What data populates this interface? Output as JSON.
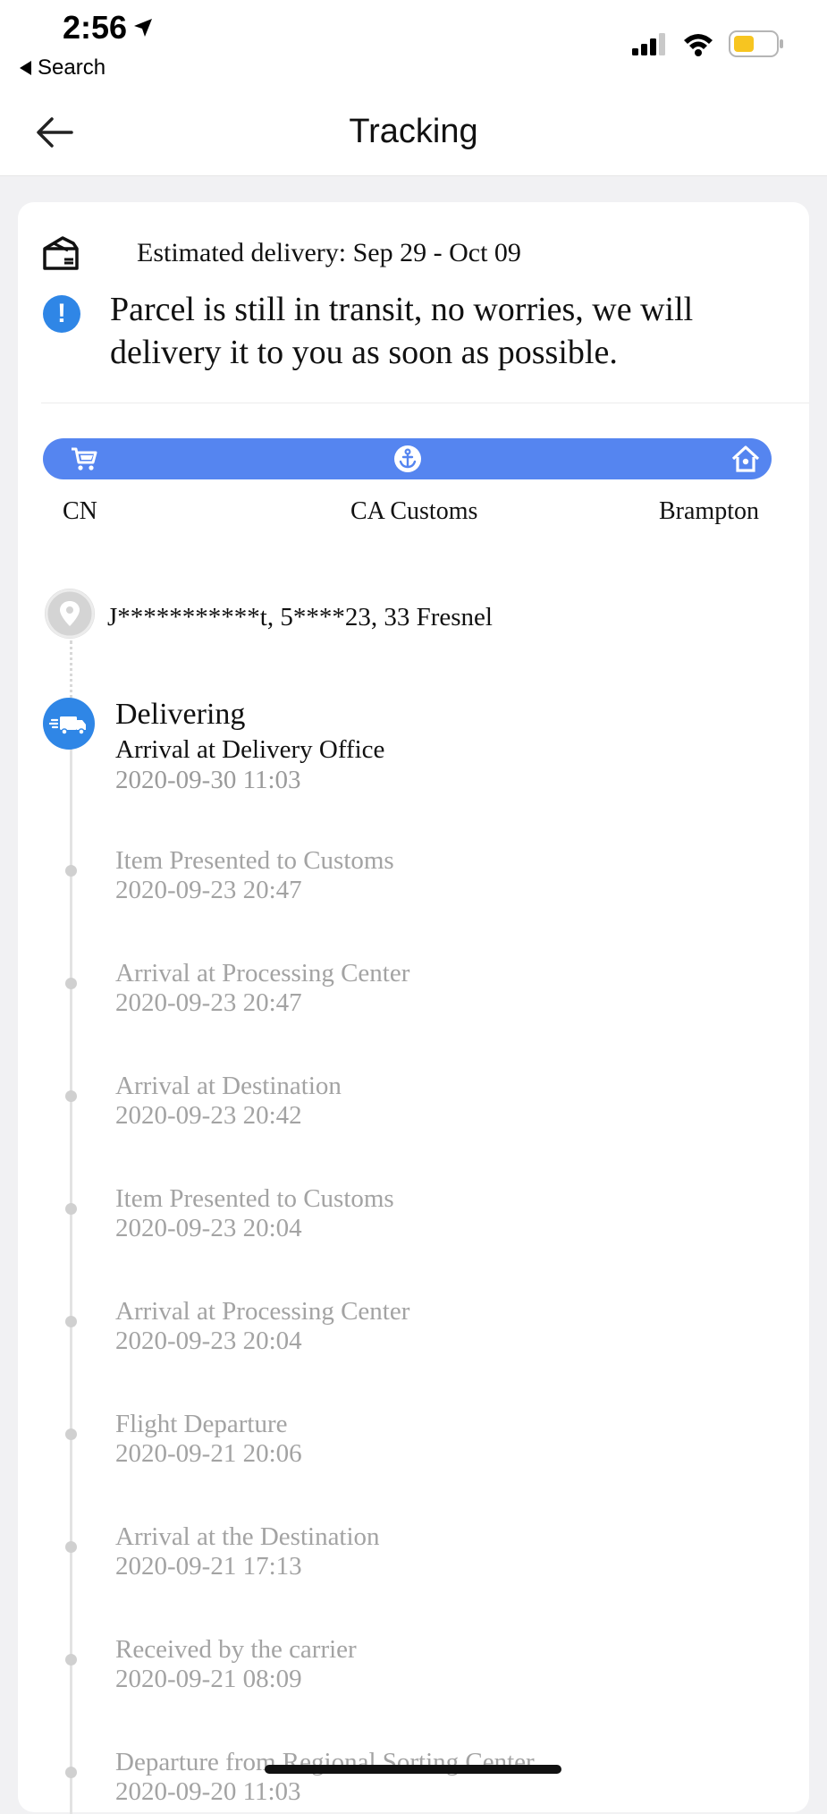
{
  "status_bar": {
    "time": "2:56",
    "back_app": "Search",
    "battery_color": "#f7c520"
  },
  "header": {
    "title": "Tracking",
    "back_icon": "arrow-left-icon"
  },
  "estimate": {
    "label": "Estimated delivery: Sep 29 - Oct 09",
    "icon": "package-icon"
  },
  "notice": {
    "text": "Parcel is still in transit, no worries, we will delivery it to you as soon as possible.",
    "icon": "exclamation-icon"
  },
  "route": {
    "bar_color": "#5585f0",
    "stops": [
      {
        "label": "CN",
        "icon": "cart-icon"
      },
      {
        "label": "CA Customs",
        "icon": "anchor-icon"
      },
      {
        "label": "Brampton",
        "icon": "home-icon"
      }
    ]
  },
  "address": {
    "text": "J***********t,  5****23,  33 Fresnel"
  },
  "current_event": {
    "status": "Delivering",
    "description": "Arrival at Delivery Office",
    "time": "2020-09-30 11:03"
  },
  "events": [
    {
      "description": "Item Presented to Customs",
      "time": "2020-09-23 20:47"
    },
    {
      "description": "Arrival at Processing Center",
      "time": "2020-09-23 20:47"
    },
    {
      "description": "Arrival at Destination",
      "time": "2020-09-23 20:42"
    },
    {
      "description": "Item Presented to Customs",
      "time": "2020-09-23 20:04"
    },
    {
      "description": "Arrival at Processing Center",
      "time": "2020-09-23 20:04"
    },
    {
      "description": "Flight Departure",
      "time": "2020-09-21 20:06"
    },
    {
      "description": "Arrival at the Destination",
      "time": "2020-09-21 17:13"
    },
    {
      "description": "Received by the carrier",
      "time": "2020-09-21 08:09"
    },
    {
      "description": "Departure from Regional Sorting Center",
      "time": "2020-09-20 11:03"
    }
  ],
  "accent_color": "#2f86e6"
}
